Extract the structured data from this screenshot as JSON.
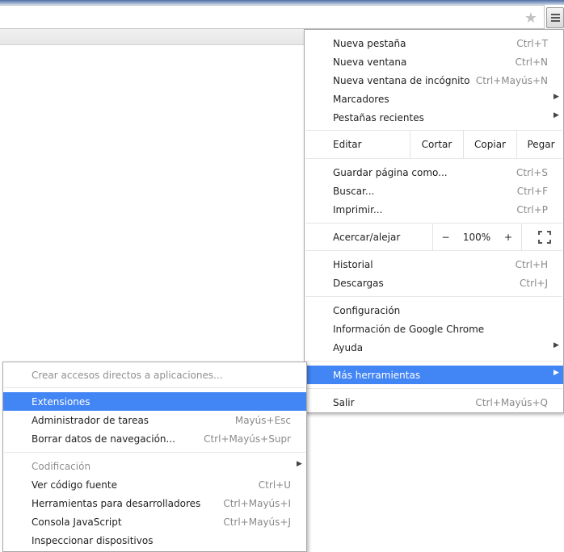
{
  "main_menu": {
    "new_tab": {
      "label": "Nueva pestaña",
      "shortcut": "Ctrl+T"
    },
    "new_window": {
      "label": "Nueva ventana",
      "shortcut": "Ctrl+N"
    },
    "incognito": {
      "label": "Nueva ventana de incógnito",
      "shortcut": "Ctrl+Mayús+N"
    },
    "bookmarks": {
      "label": "Marcadores"
    },
    "recent_tabs": {
      "label": "Pestañas recientes"
    },
    "edit": {
      "label": "Editar",
      "cut": "Cortar",
      "copy": "Copiar",
      "paste": "Pegar"
    },
    "save_page": {
      "label": "Guardar página como...",
      "shortcut": "Ctrl+S"
    },
    "find": {
      "label": "Buscar...",
      "shortcut": "Ctrl+F"
    },
    "print": {
      "label": "Imprimir...",
      "shortcut": "Ctrl+P"
    },
    "zoom": {
      "label": "Acercar/alejar",
      "minus": "−",
      "value": "100%",
      "plus": "+"
    },
    "history": {
      "label": "Historial",
      "shortcut": "Ctrl+H"
    },
    "downloads": {
      "label": "Descargas",
      "shortcut": "Ctrl+J"
    },
    "settings": {
      "label": "Configuración"
    },
    "about": {
      "label": "Información de Google Chrome"
    },
    "help": {
      "label": "Ayuda"
    },
    "more_tools": {
      "label": "Más herramientas"
    },
    "exit": {
      "label": "Salir",
      "shortcut": "Ctrl+Mayús+Q"
    }
  },
  "sub_menu": {
    "create_shortcuts": {
      "label": "Crear accesos directos a aplicaciones..."
    },
    "extensions": {
      "label": "Extensiones"
    },
    "task_manager": {
      "label": "Administrador de tareas",
      "shortcut": "Mayús+Esc"
    },
    "clear_data": {
      "label": "Borrar datos de navegación...",
      "shortcut": "Ctrl+Mayús+Supr"
    },
    "encoding": {
      "label": "Codificación"
    },
    "view_source": {
      "label": "Ver código fuente",
      "shortcut": "Ctrl+U"
    },
    "dev_tools": {
      "label": "Herramientas para desarrolladores",
      "shortcut": "Ctrl+Mayús+I"
    },
    "js_console": {
      "label": "Consola JavaScript",
      "shortcut": "Ctrl+Mayús+J"
    },
    "inspect_devices": {
      "label": "Inspeccionar dispositivos"
    }
  },
  "colors": {
    "highlight": "#4285f4"
  },
  "icons": {
    "star": "star-icon",
    "menu": "hamburger-menu-icon",
    "submenu": "chevron-right-icon",
    "fullscreen": "fullscreen-icon"
  }
}
